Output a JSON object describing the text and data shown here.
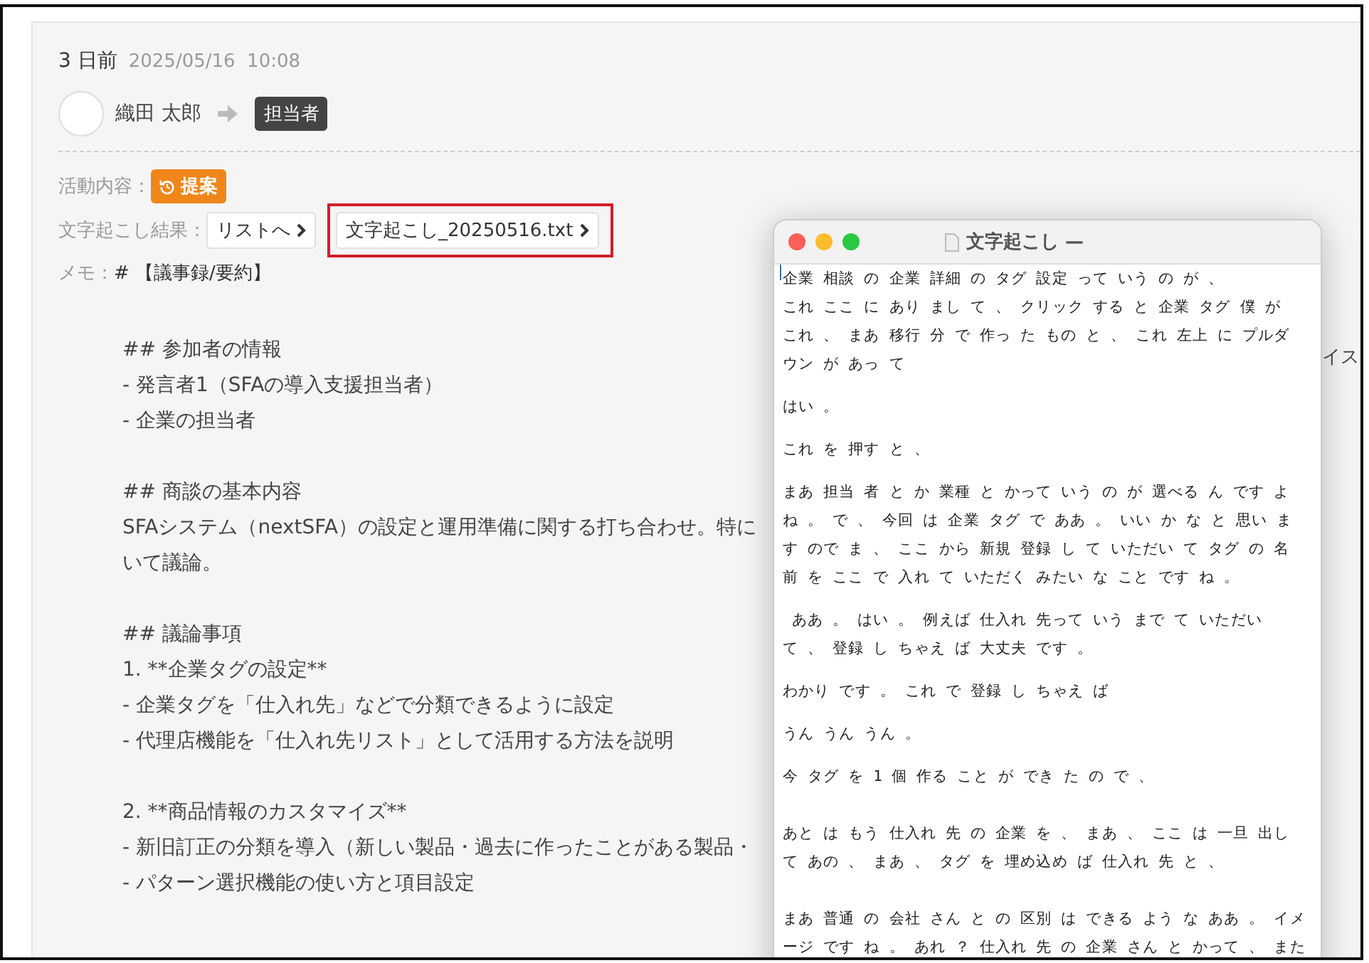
{
  "header": {
    "relative_time": "3 日前",
    "timestamp": "2025/05/16  10:08"
  },
  "assignment": {
    "from": "織田 太郎",
    "to": "担当者"
  },
  "fields": [
    {
      "kind": "tag",
      "label": "活動内容：",
      "value": "提案"
    },
    {
      "kind": "links",
      "label": "文字起こし結果：",
      "links": [
        {
          "text": "リストへ",
          "highlighted": false
        },
        {
          "text": "文字起こし_20250516.txt",
          "highlighted": true
        }
      ]
    },
    {
      "kind": "text",
      "label": "メモ：",
      "value": "# 【議事録/要約】"
    }
  ],
  "memo_sections": [
    [
      "## 参加者の情報",
      "- 発言者1（SFAの導入支援担当者）",
      "- 企業の担当者"
    ],
    [
      "## 商談の基本内容",
      "SFAシステム（nextSFA）の設定と運用準備に関する打ち合わせ。特に",
      "いて議論。"
    ],
    [
      "## 議論事項",
      "1. **企業タグの設定**",
      "- 企業タグを「仕入れ先」などで分類できるように設定",
      "- 代理店機能を「仕入れ先リスト」として活用する方法を説明"
    ],
    [
      "2. **商品情報のカスタマイズ**",
      "- 新旧訂正の分類を導入（新しい製品・過去に作ったことがある製品・",
      "- パターン選択機能の使い方と項目設定"
    ]
  ],
  "memo_overflow": "イス",
  "transcript_window": {
    "title": "文字起こし —",
    "blocks": [
      [
        [
          "企業 相談 の 企業 詳細 の タグ 設定 って いう の が 、",
          "これ ここ に あり まし て 、 クリック する と 企業 タグ 僕 が",
          "これ 、 まあ 移行 分 で 作っ た もの と 、 これ 左上 に プルダ",
          "ウン が あっ て"
        ],
        [
          "はい 。"
        ],
        [
          "これ を 押す と 、"
        ],
        [
          "まあ 担当 者 と か 業種 と かって いう の が 選べる ん です よ",
          "ね 。 で 、 今回 は 企業 タグ で ああ 。 いい か な と 思い ま",
          "す ので ま 、 ここ から 新規 登録 し て いただい て タグ の 名",
          "前 を ここ で 入れ て いただく みたい な こと です ね 。"
        ],
        [
          " ああ 。 はい 。 例えば 仕入れ 先って いう まで て いただい",
          "て 、 登録 し ちゃえ ば 大丈夫 です 。"
        ],
        [
          "わかり です 。 これ で 登録 し ちゃえ ば"
        ],
        [
          "うん うん うん 。"
        ],
        [
          "今 タグ を 1 個 作る こと が でき た の で 、"
        ]
      ],
      [
        [
          "あと は もう 仕入れ 先 の 企業 を 、 まあ 、 ここ は 一旦 出し",
          "て あの 、 まあ 、 タグ を 埋め込め ば 仕入れ 先 と 、"
        ]
      ],
      [
        [
          "まあ 普通 の 会社 さん と の 区別 は できる よう な ああ 。 イメ",
          "ージ です ね 。 あれ ？ 仕入れ 先 の 企業 さん と かって 、 また"
        ]
      ]
    ]
  }
}
